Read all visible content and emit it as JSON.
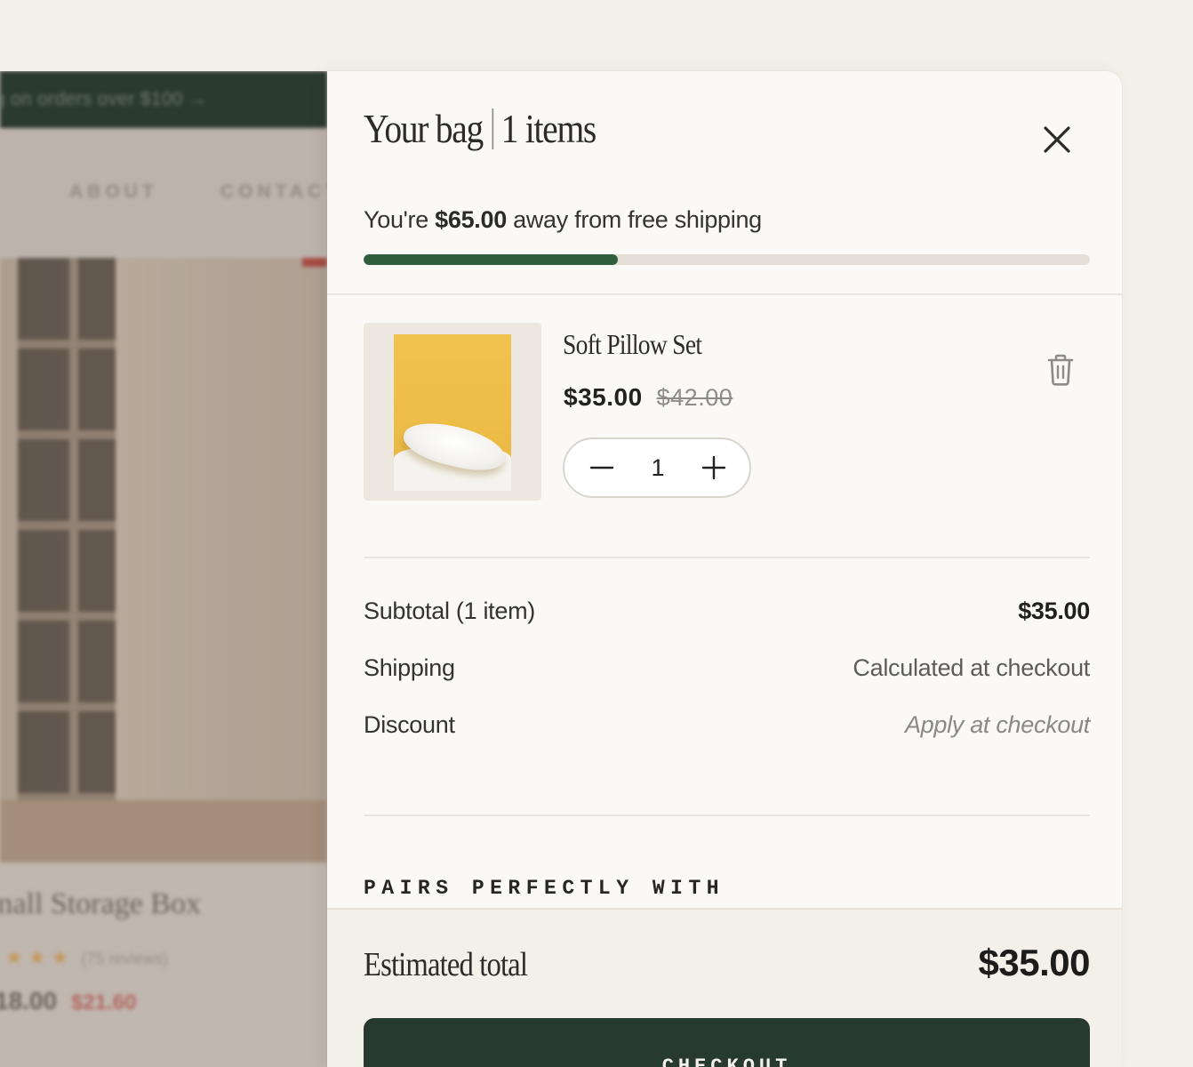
{
  "background_page": {
    "banner_text": "ng on orders over $100 →",
    "nav": [
      "ABOUT",
      "CONTACT"
    ],
    "product_title": "mall Storage Box",
    "rating_stars": "★★★",
    "reviews": "(75 reviews)",
    "price": "18.00",
    "price_old": "$21.60"
  },
  "cart": {
    "title": "Your bag",
    "item_count_label": "1 items",
    "free_shipping": {
      "prefix": "You're",
      "amount": "$65.00",
      "suffix": "away from free shipping",
      "progress_fraction": 0.35
    },
    "items": [
      {
        "name": "Soft Pillow Set",
        "price": "$35.00",
        "compare_at_price": "$42.00",
        "quantity": "1"
      }
    ],
    "summary": {
      "subtotal_label": "Subtotal (1 item)",
      "subtotal_value": "$35.00",
      "shipping_label": "Shipping",
      "shipping_value": "Calculated at checkout",
      "discount_label": "Discount",
      "discount_value": "Apply at checkout"
    },
    "pairs_title": "PAIRS PERFECTLY WITH",
    "estimated_total_label": "Estimated total",
    "estimated_total_value": "$35.00",
    "checkout_label": "CHECKOUT"
  },
  "icons": {
    "close": "close-icon",
    "trash": "trash-icon",
    "minus": "minus-icon",
    "plus": "plus-icon"
  },
  "colors": {
    "accent_green": "#2f5e3d",
    "checkout_bg": "#263a2f",
    "drawer_bg": "#faf9f6"
  }
}
